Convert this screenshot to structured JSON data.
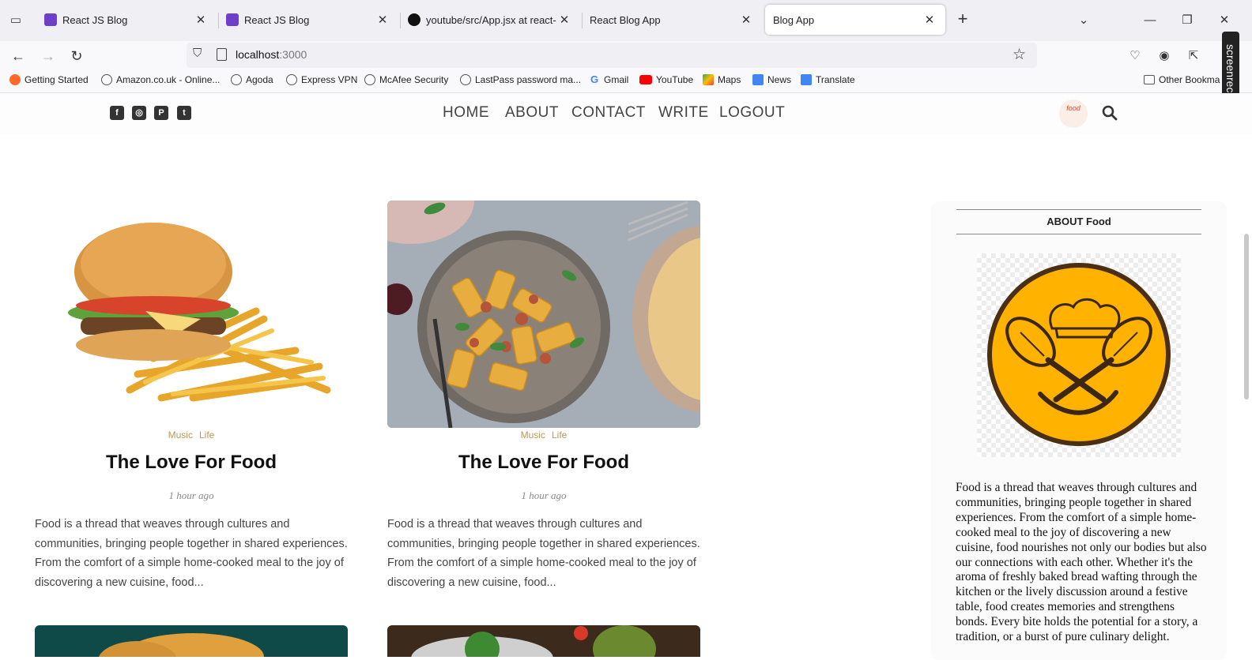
{
  "browser": {
    "tabs": [
      {
        "title": "React JS Blog",
        "favicon_color": "#6e3fc9",
        "active": false
      },
      {
        "title": "React JS Blog",
        "favicon_color": "#6e3fc9",
        "active": false
      },
      {
        "title": "youtube/src/App.jsx at react-bl",
        "favicon_color": "#111111",
        "active": false
      },
      {
        "title": "React Blog App",
        "favicon_color": "",
        "active": false
      },
      {
        "title": "Blog App",
        "favicon_color": "",
        "active": true
      }
    ],
    "url_host": "localhost",
    "url_port": ":3000",
    "bookmarks": [
      {
        "label": "Getting Started",
        "icon": "firefox-icon"
      },
      {
        "label": "Amazon.co.uk - Online...",
        "icon": "globe-icon"
      },
      {
        "label": "Agoda",
        "icon": "globe-icon"
      },
      {
        "label": "Express VPN",
        "icon": "globe-icon"
      },
      {
        "label": "McAfee Security",
        "icon": "globe-icon"
      },
      {
        "label": "LastPass password ma...",
        "icon": "globe-icon"
      },
      {
        "label": "Gmail",
        "icon": "google-icon"
      },
      {
        "label": "YouTube",
        "icon": "youtube-icon"
      },
      {
        "label": "Maps",
        "icon": "maps-icon"
      },
      {
        "label": "News",
        "icon": "news-icon"
      },
      {
        "label": "Translate",
        "icon": "translate-icon"
      }
    ],
    "other_bookmarks": "Other Bookma",
    "recorder_label": "screenrec"
  },
  "site": {
    "social": [
      "facebook-icon",
      "instagram-icon",
      "pinterest-icon",
      "twitter-icon"
    ],
    "menu": [
      "HOME",
      "ABOUT",
      "CONTACT",
      "WRITE",
      "LOGOUT"
    ],
    "logo_text": "food"
  },
  "posts": [
    {
      "categories": [
        "Music",
        "Life"
      ],
      "title": "The Love For Food",
      "date": "1 hour ago",
      "desc": "Food is a thread that weaves through cultures and communities, bringing people together in shared experiences. From the comfort of a simple home-cooked meal to the joy of discovering a new cuisine, food..."
    },
    {
      "categories": [
        "Music",
        "Life"
      ],
      "title": "The Love For Food",
      "date": "1 hour ago",
      "desc": "Food is a thread that weaves through cultures and communities, bringing people together in shared experiences. From the comfort of a simple home-cooked meal to the joy of discovering a new cuisine, food..."
    }
  ],
  "sidebar": {
    "title": "ABOUT Food",
    "text": "Food is a thread that weaves through cultures and communities, bringing people together in shared experiences. From the comfort of a simple home-cooked meal to the joy of discovering a new cuisine, food nourishes not only our bodies but also our connections with each other. Whether it's the aroma of freshly baked bread wafting through the kitchen or the lively discussion around a festive table, food creates memories and strengthens bonds. Every bite holds the potential for a story, a tradition, or a burst of pure culinary delight.",
    "logo_color": "#ffb300"
  }
}
